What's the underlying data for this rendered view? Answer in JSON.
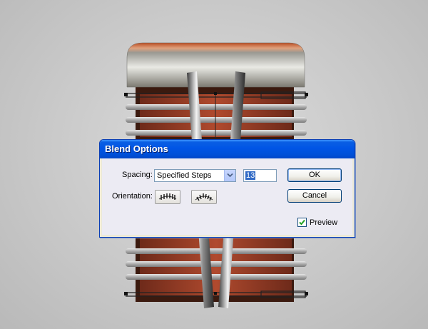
{
  "dialog": {
    "title": "Blend Options",
    "spacing_label": "Spacing:",
    "spacing_value": "Specified Steps",
    "steps_value": "13",
    "orientation_label": "Orientation:",
    "ok_label": "OK",
    "cancel_label": "Cancel",
    "preview_label": "Preview",
    "preview_checked": true
  },
  "icons": {
    "dropdown": "chevron-down-icon",
    "align_page": "orientation-align-to-page-icon",
    "align_path": "orientation-align-to-path-icon",
    "checkbox": "checkmark-icon"
  },
  "colors": {
    "titlebar": "#0055e5",
    "selection": "#316ac5",
    "checkmark": "#21a121",
    "copper": "#c0603a",
    "brick": "#a8422b"
  }
}
